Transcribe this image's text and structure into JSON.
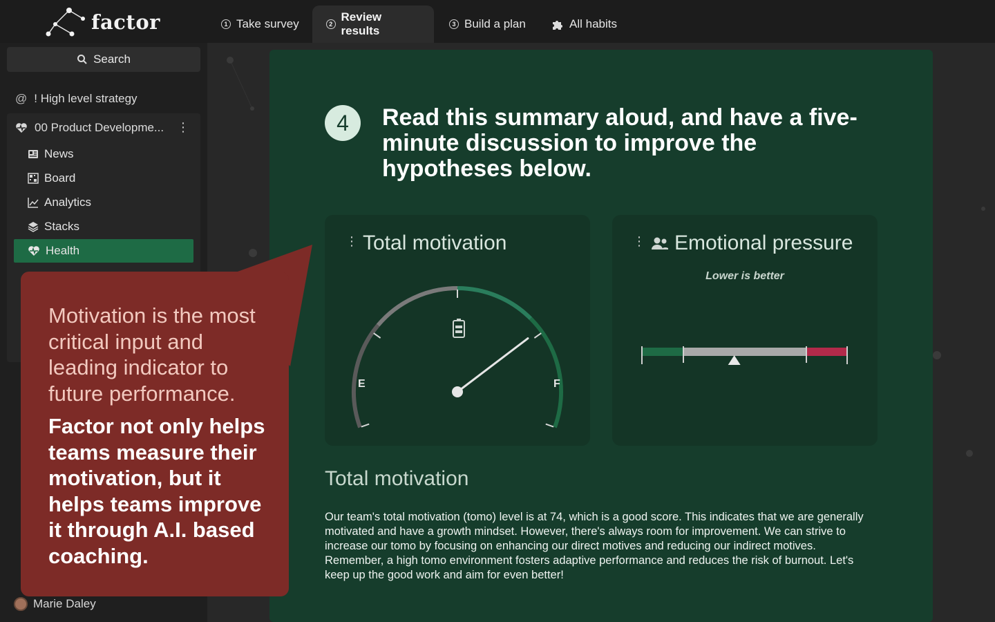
{
  "app": {
    "name": "factor"
  },
  "tabs": [
    {
      "label": "Take survey",
      "num": "1"
    },
    {
      "label": "Review results",
      "num": "2"
    },
    {
      "label": "Build a plan",
      "num": "3"
    },
    {
      "label": "All habits"
    }
  ],
  "sidebar": {
    "search_label": "Search",
    "high_level": "! High level strategy",
    "group_title": "00 Product Developme...",
    "items": [
      {
        "label": "News"
      },
      {
        "label": "Board"
      },
      {
        "label": "Analytics"
      },
      {
        "label": "Stacks"
      },
      {
        "label": "Health"
      }
    ],
    "user_name": "Marie Daley"
  },
  "step": {
    "number": "4",
    "headline": "Read this summary aloud, and have a five-minute discussion to improve the hypotheses below."
  },
  "panels": {
    "total_motivation": {
      "title": "Total motivation",
      "empty_label": "E",
      "full_label": "F",
      "value": 74
    },
    "emotional_pressure": {
      "title": "Emotional pressure",
      "subtitle": "Lower is better",
      "marker_fraction": 0.45
    }
  },
  "summary": {
    "title": "Total motivation",
    "body": "Our team's total motivation (tomo) level is at 74, which is a good score. This indicates that we are generally motivated and have a growth mindset. However, there's always room for improvement. We can strive to increase our tomo by focusing on enhancing our direct motives and reducing our indirect motives. Remember, a high tomo environment fosters adaptive performance and reduces the risk of burnout. Let's keep up the good work and aim for even better!"
  },
  "callout": {
    "light_text": "Motivation is the most critical input and leading indicator to future performance.",
    "bold_text": "Factor not only helps teams measure their motivation, but it helps teams improve it through A.I. based coaching."
  },
  "colors": {
    "accent_green": "#1e6b45",
    "card_green": "#163d2c",
    "callout_red": "#7d2b27",
    "pressure_red": "#b32a4a"
  }
}
